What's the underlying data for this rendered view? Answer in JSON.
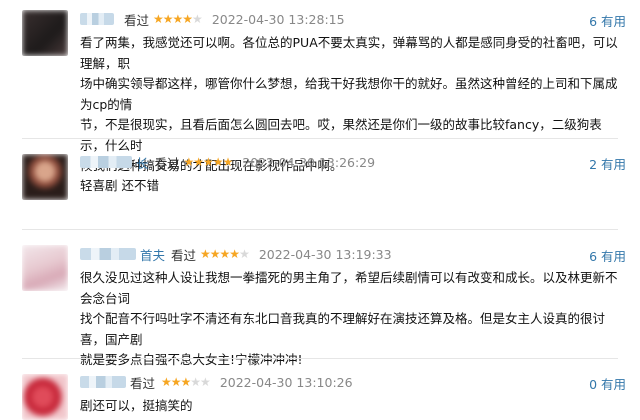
{
  "reviews": [
    {
      "name_tail": "",
      "seen": "看过",
      "stars": 4,
      "time": "2022-04-30 13:28:15",
      "useful": "6 有用",
      "lines": [
        "看了两集，我感觉还可以啊。各位总的PUA不要太真实，弹幕骂的人都是感同身受的社畜吧，可以理解，职",
        "场中确实领导都这样，哪管你什么梦想，给我干好我想你干的就好。虽然这种曾经的上司和下属成为cp的情",
        "节，不是很现实，且看后面怎么圆回去吧。哎，果然还是你们一级的故事比较fancy，二级狗表示，什么时",
        "候我们这种搞交易的才配出现在影视作品中啊。"
      ]
    },
    {
      "name_tail": "长",
      "seen": "看过",
      "stars": 5,
      "time": "2022-04-30 13:26:29",
      "useful": "2 有用",
      "lines": [
        "轻喜剧 还不错"
      ]
    },
    {
      "name_tail": "首夫",
      "seen": "看过",
      "stars": 4,
      "time": "2022-04-30 13:19:33",
      "useful": "6 有用",
      "lines": [
        "很久没见过这种人设让我想一拳擂死的男主角了，希望后续剧情可以有改变和成长。以及林更新不会念台词",
        "找个配音不行吗吐字不清还有东北口音我真的不理解好在演技还算及格。但是女主人设真的很讨喜，国产剧",
        "就是要多点自强不息大女主!宁檬冲冲冲!"
      ]
    },
    {
      "name_tail": "看过",
      "seen": "",
      "stars": 3,
      "time": "2022-04-30 13:10:26",
      "useful": "0 有用",
      "lines": [
        "剧还可以，挺搞笑的"
      ]
    }
  ]
}
